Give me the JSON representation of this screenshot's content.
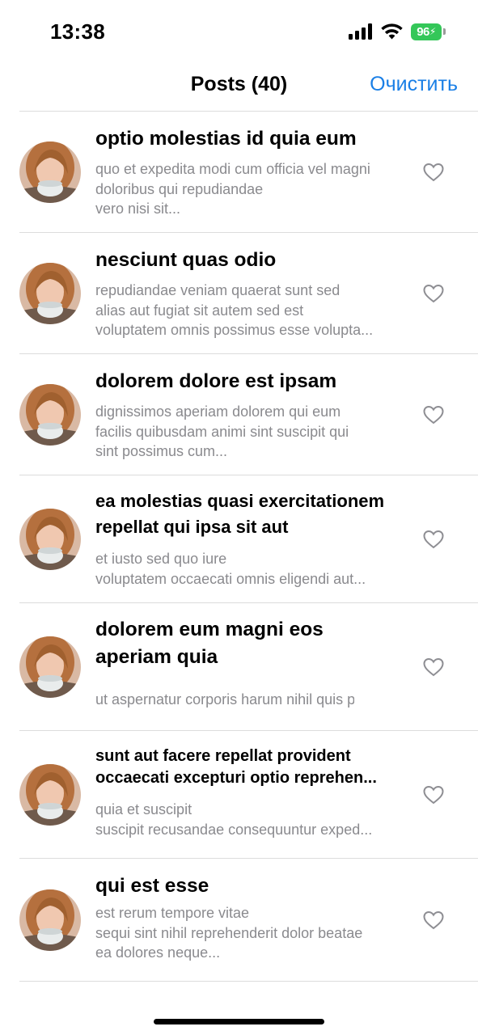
{
  "status": {
    "time": "13:38",
    "battery": "96"
  },
  "nav": {
    "title": "Posts (40)",
    "clear_label": "Очистить"
  },
  "posts": [
    {
      "title": "optio molestias id quia eum",
      "body": [
        "quo et expedita modi cum officia vel magni",
        "doloribus qui repudiandae",
        "vero nisi sit..."
      ]
    },
    {
      "title": "nesciunt quas odio",
      "body": [
        "repudiandae veniam quaerat sunt sed",
        "alias aut fugiat sit autem sed est",
        "voluptatem omnis possimus esse volupta..."
      ]
    },
    {
      "title": "dolorem dolore est ipsam",
      "body": [
        "dignissimos aperiam dolorem qui eum",
        "facilis quibusdam animi sint suscipit qui",
        "sint possimus cum..."
      ]
    },
    {
      "title": "ea molestias quasi exercitationem repellat qui ipsa sit aut",
      "body": [
        "et iusto sed quo iure",
        "voluptatem occaecati omnis eligendi aut..."
      ]
    },
    {
      "title": "dolorem eum magni eos aperiam quia",
      "body": [
        "ut aspernatur corporis harum nihil quis pr..."
      ]
    },
    {
      "title": "sunt aut facere repellat provident occaecati excepturi optio reprehen...",
      "body": [
        "quia et suscipit",
        "suscipit recusandae consequuntur exped..."
      ]
    },
    {
      "title": "qui est esse",
      "body": [
        "est rerum tempore vitae",
        "sequi sint nihil reprehenderit dolor beatae",
        "ea dolores neque..."
      ]
    }
  ]
}
